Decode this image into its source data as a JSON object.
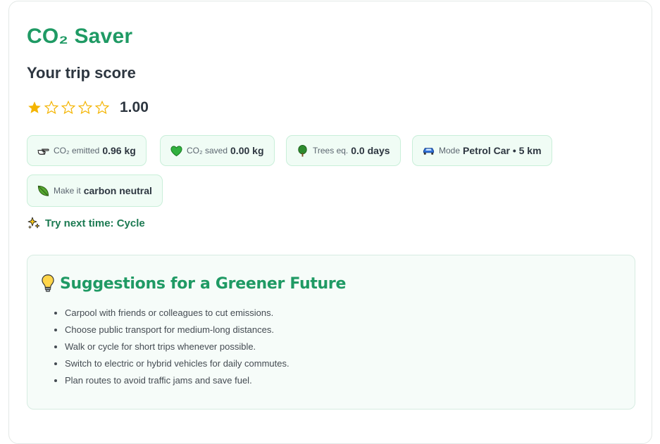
{
  "app": {
    "title": "CO₂ Saver"
  },
  "result": {
    "heading": "Your trip score",
    "rating": {
      "value": 1,
      "max": 5,
      "score_text": "1.00"
    }
  },
  "stats": [
    {
      "icon": "pointing-hand-icon",
      "label": "CO₂ emitted",
      "value": "0.96 kg"
    },
    {
      "icon": "green-heart-icon",
      "label": "CO₂ saved",
      "value": "0.00 kg"
    },
    {
      "icon": "tree-icon",
      "label": "Trees eq.",
      "value": "0.0 days"
    },
    {
      "icon": "car-icon",
      "label": "Mode",
      "value": "Petrol Car • 5 km"
    },
    {
      "icon": "leaf-icon",
      "label": "Make it",
      "value": "carbon neutral"
    }
  ],
  "tip": {
    "icon": "sparkles-icon",
    "text": "Try next time: Cycle"
  },
  "suggestions": {
    "icon": "lightbulb-icon",
    "title": "Suggestions for a Greener Future",
    "items": [
      "Carpool with friends or colleagues to cut emissions.",
      "Choose public transport for medium-long distances.",
      "Walk or cycle for short trips whenever possible.",
      "Switch to electric or hybrid vehicles for daily commutes.",
      "Plan routes to avoid traffic jams and save fuel."
    ]
  },
  "colors": {
    "brand_green": "#1f9a64",
    "chip_bg": "#f0fcf5",
    "chip_border": "#c9efd9",
    "star_gold": "#f4b400",
    "text_dark": "#2d3640"
  }
}
